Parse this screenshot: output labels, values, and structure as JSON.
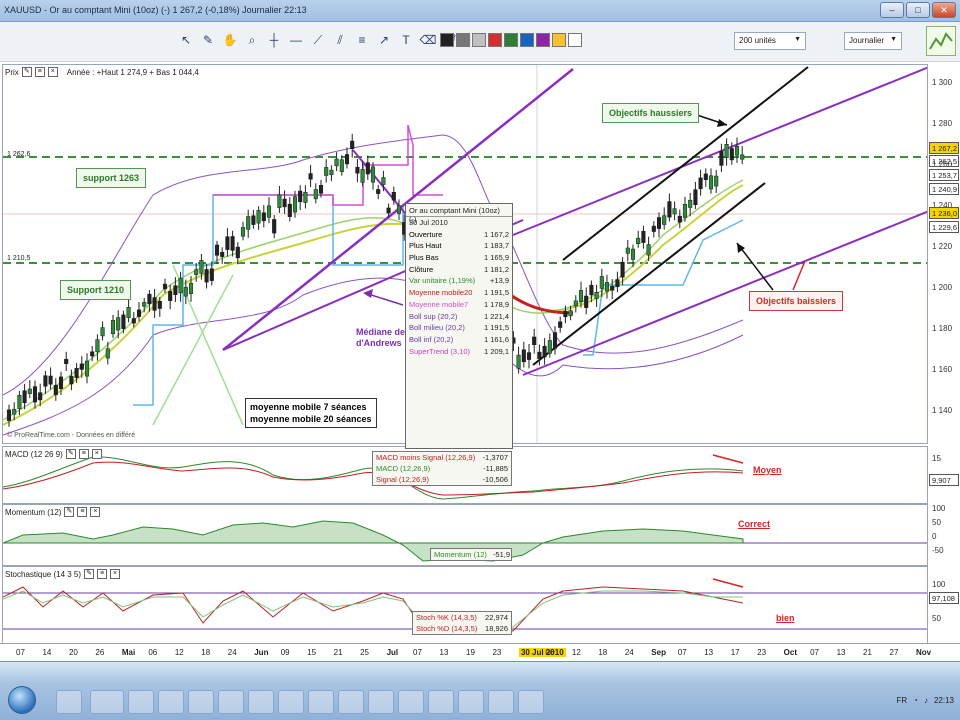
{
  "window": {
    "title": "XAUUSD - Or au comptant Mini (10oz) (-)   1 267,2 (-0,18%)   Journalier 22:13"
  },
  "toolbar": {
    "units_select": "200 unités",
    "period_select": "Journalier"
  },
  "price_pane": {
    "header": "Année : +Haut 1 274,9 + Bas 1 044,4",
    "pane_label": "Prix",
    "watermark": "© ProRealTime.com - Données en différé",
    "price_marks": {
      "left_1263": "1 262,6",
      "left_1210": "1 210,5"
    },
    "scale": [
      "1 300",
      "1 280",
      "1 260",
      "1 240",
      "1 220",
      "1 200",
      "1 180",
      "1 160",
      "1 140"
    ],
    "tags": [
      {
        "text": "1 267,2",
        "color": "#f5d400"
      },
      {
        "text": "1 262,5",
        "color": "#ffffff"
      },
      {
        "text": "1 253,7",
        "color": "#ffffff"
      },
      {
        "text": "1 240,9",
        "color": "#ffffff"
      },
      {
        "text": "1 236,0",
        "color": "#f5d400"
      },
      {
        "text": "1 229,6",
        "color": "#ffffff"
      }
    ],
    "annotations": {
      "support_1263": "support 1263",
      "support_1210": "Support 1210",
      "objectifs_haussiers": "Objectifs haussiers",
      "objectifs_baissiers": "Objectifs baissiers",
      "mediane_line1": "Médiane de la",
      "mediane_line2": "d'Andrews",
      "mm_line1": "moyenne mobile 7 séances",
      "mm_line2": "moyenne mobile 20 séances"
    }
  },
  "infobox": {
    "title": "Or au comptant Mini (10oz) (-)",
    "date": "30 Jul 2010",
    "rows": [
      {
        "k": "Ouverture",
        "v": "1 167,2",
        "c": "#000"
      },
      {
        "k": "Plus Haut",
        "v": "1 183,7",
        "c": "#000"
      },
      {
        "k": "Plus Bas",
        "v": "1 165,9",
        "c": "#000"
      },
      {
        "k": "Clôture",
        "v": "1 181,2",
        "c": "#000"
      },
      {
        "k": "Var unitaire (1,19%)",
        "v": "+13,9",
        "c": "#2a8a2a"
      },
      {
        "k": "Moyenne mobile20",
        "v": "1 191,5",
        "c": "#c02020"
      },
      {
        "k": "Moyenne mobile7",
        "v": "1 178,9",
        "c": "#d04fd0"
      },
      {
        "k": "Boll sup (20,2)",
        "v": "1 221,4",
        "c": "#6a3aa8"
      },
      {
        "k": "Boll milieu (20,2)",
        "v": "1 191,5",
        "c": "#6a3aa8"
      },
      {
        "k": "Boll inf (20,2)",
        "v": "1 161,6",
        "c": "#6a3aa8"
      },
      {
        "k": "SuperTrend (3,10)",
        "v": "1 209,1",
        "c": "#c040c0"
      }
    ]
  },
  "macd_pane": {
    "label": "MACD (12 26 9)",
    "legend": [
      {
        "k": "MACD moins Signal (12,26,9)",
        "v": "-1,3707",
        "c": "#c02020"
      },
      {
        "k": "MACD (12,26,9)",
        "v": "-11,885",
        "c": "#2a8a2a"
      },
      {
        "k": "Signal (12,26,9)",
        "v": "-10,506",
        "c": "#c02020"
      }
    ],
    "scale": [
      "15"
    ],
    "tag": "9,907",
    "note": "Moyen"
  },
  "momentum_pane": {
    "label": "Momentum (12)",
    "legend": [
      {
        "k": "Momentum (12)",
        "v": "-51,9",
        "c": "#2a8a2a"
      }
    ],
    "scale": [
      "100",
      "50",
      "0",
      "-50"
    ],
    "note": "Correct"
  },
  "stoch_pane": {
    "label": "Stochastique (14 3 5)",
    "legend": [
      {
        "k": "Stoch %K (14,3,5)",
        "v": "22,974",
        "c": "#c02020"
      },
      {
        "k": "Stoch %D (14,3,5)",
        "v": "18,926",
        "c": "#c02020"
      }
    ],
    "scale": [
      "100",
      "50"
    ],
    "tag": "97,108",
    "note": "bien"
  },
  "xaxis": {
    "labels": [
      "07",
      "14",
      "20",
      "26",
      "Mai",
      "06",
      "12",
      "18",
      "24",
      "Jun",
      "09",
      "15",
      "21",
      "25",
      "Jul",
      "07",
      "13",
      "19",
      "23",
      "30 Jul 2010",
      "06",
      "12",
      "18",
      "24",
      "Sep",
      "07",
      "13",
      "17",
      "23",
      "Oct",
      "07",
      "13",
      "21",
      "27",
      "Nov"
    ]
  },
  "taskbar": {
    "lang": "FR",
    "time": "22:13"
  }
}
